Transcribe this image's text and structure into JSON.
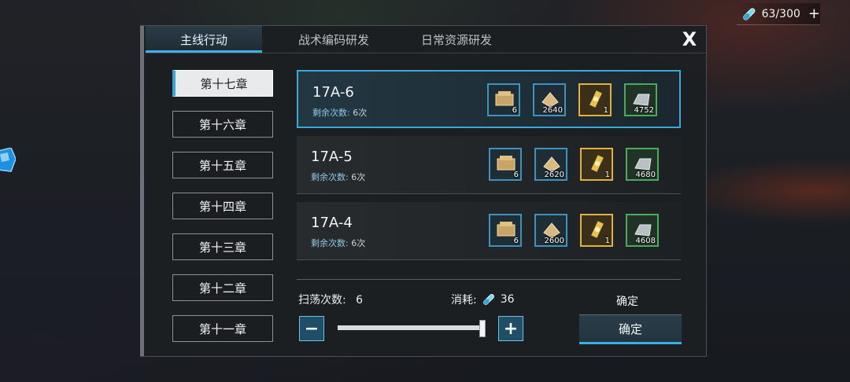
{
  "energy": {
    "value": "63/300",
    "plus": "+",
    "icon": "vial-icon"
  },
  "tabs": [
    {
      "label": "主线行动",
      "active": true
    },
    {
      "label": "战术编码研发",
      "active": false
    },
    {
      "label": "日常资源研发",
      "active": false
    }
  ],
  "close": "X",
  "chapters": [
    "第十七章",
    "第十六章",
    "第十五章",
    "第十四章",
    "第十三章",
    "第十二章",
    "第十一章"
  ],
  "stages": [
    {
      "name": "17A-6",
      "remain_label": "剩余次数:",
      "remain_value": "6次",
      "rewards": [
        {
          "icon": "supply-box-icon",
          "count": "6"
        },
        {
          "icon": "ration-icon",
          "count": "2640"
        },
        {
          "icon": "core-icon",
          "count": "1"
        },
        {
          "icon": "parts-icon",
          "count": "4752"
        }
      ]
    },
    {
      "name": "17A-5",
      "remain_label": "剩余次数:",
      "remain_value": "6次",
      "rewards": [
        {
          "icon": "supply-box-icon",
          "count": "6"
        },
        {
          "icon": "ration-icon",
          "count": "2620"
        },
        {
          "icon": "core-icon",
          "count": "1"
        },
        {
          "icon": "parts-icon",
          "count": "4680"
        }
      ]
    },
    {
      "name": "17A-4",
      "remain_label": "剩余次数:",
      "remain_value": "6次",
      "rewards": [
        {
          "icon": "supply-box-icon",
          "count": "6"
        },
        {
          "icon": "ration-icon",
          "count": "2600"
        },
        {
          "icon": "core-icon",
          "count": "1"
        },
        {
          "icon": "parts-icon",
          "count": "4608"
        }
      ]
    }
  ],
  "sweep": {
    "label": "扫荡次数:",
    "value": "6"
  },
  "cost": {
    "label": "消耗:",
    "value": "36"
  },
  "confirm_label_top": "确定",
  "confirm_button": "确定",
  "minus": "−",
  "plus": "+",
  "colors": {
    "accent": "#3ab0e6",
    "gold": "#e0b23a",
    "green": "#4cab5a"
  }
}
